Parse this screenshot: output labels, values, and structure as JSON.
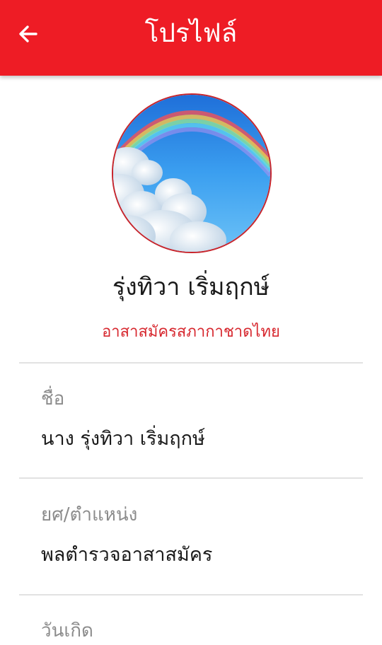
{
  "appbar": {
    "title": "โปรไฟล์",
    "back_icon": "arrow-left-icon",
    "color": "#ee1c25"
  },
  "profile": {
    "avatar_icon": "rainbow-sky-photo",
    "name": "รุ่งทิวา เริ่มฤกษ์",
    "organization": "อาสาสมัครสภากาชาดไทย",
    "accent_color": "#d7282f"
  },
  "fields": [
    {
      "label": "ชื่อ",
      "value": "นาง รุ่งทิวา เริ่มฤกษ์"
    },
    {
      "label": "ยศ/ตำแหน่ง",
      "value": "พลตำรวจอาสาสมัคร"
    },
    {
      "label": "วันเกิด",
      "value": ""
    }
  ]
}
